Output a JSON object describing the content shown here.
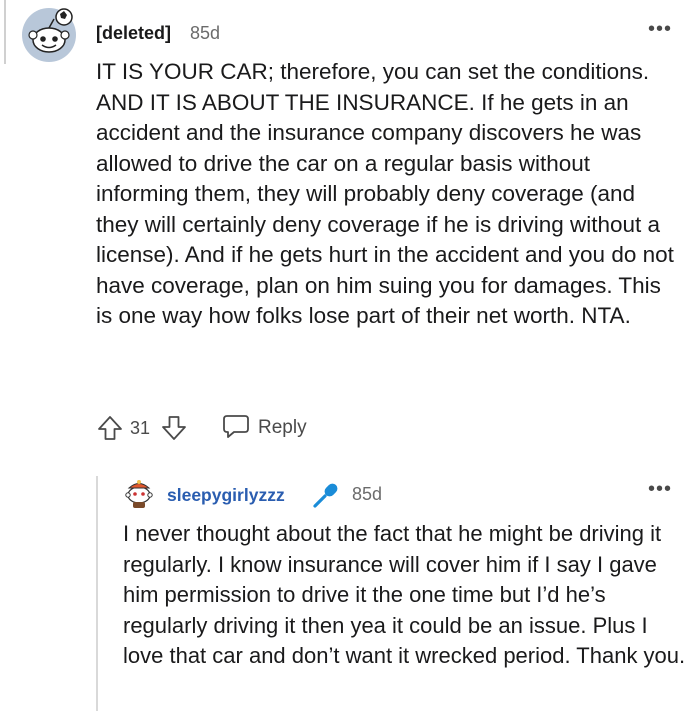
{
  "comments": [
    {
      "author": "[deleted]",
      "age": "85d",
      "avatar_icon": "snoo-avatar-icon",
      "more_icon": "more-options-icon",
      "more_label": "•••",
      "body": "IT IS YOUR CAR; therefore, you can set the conditions. AND IT IS ABOUT THE INSURANCE. If he gets in an accident and the insurance company discovers he was allowed to drive the car on a regular basis without informing them, they will probably deny coverage (and they will certainly deny coverage if he is driving without a license). And if he gets hurt in the accident and you do not have coverage, plan on him suing you for damages. This is one way how folks lose part of their net worth. NTA.",
      "score": "31",
      "reply_label": "Reply",
      "upvote_icon": "upvote-arrow-icon",
      "downvote_icon": "downvote-arrow-icon",
      "reply_icon": "reply-bubble-icon"
    },
    {
      "author": "sleepygirlyzzz",
      "author_color": "#2a5db0",
      "age": "85d",
      "avatar_icon": "user-avatar-icon",
      "badge_icon": "microphone-icon",
      "more_label": "•••",
      "body": "I never thought about the fact that he might be driving it regularly. I know insurance will cover him if I say I gave him permission to drive it the one time but I’d he’s regularly driving it then yea it could be an issue. Plus I love that car and don’t want it wrecked period. Thank you."
    }
  ],
  "colors": {
    "text": "#1a1a1b",
    "muted": "#6b6b6b",
    "link": "#2a5db0",
    "badge": "#1a8cd8"
  }
}
